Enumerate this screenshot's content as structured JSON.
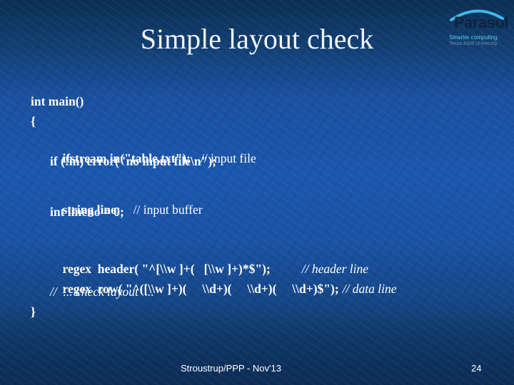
{
  "slide": {
    "title": "Simple layout check",
    "logo": {
      "name": "Parasol",
      "tagline": "Smarter computing.",
      "subtag": "Texas A&M University",
      "colors": {
        "arc": "#3fb8f0",
        "wordmark": "#0d2440",
        "tagline": "#5fd0f0"
      }
    },
    "code": {
      "l1": "int main()",
      "l2": "{",
      "l3_code": "ifstream in(\"table.txt\");",
      "l3_comment": "// input file",
      "l4": "if (!in) error(\"no input file\\n\");",
      "l5_code": "string line;",
      "l5_comment": "// input buffer",
      "l6": "int lineno = 0;",
      "l7_code": "regex  header( \"^[\\\\w ]+(   [\\\\w ]+)*$\");",
      "l7_comment": "// header line",
      "l8_code": "regex  row( \"^([\\\\w ]+)(     \\\\d+)(     \\\\d+)(     \\\\d+)$\");",
      "l8_comment": "// data line",
      "l9": "//  ... check layout  ...",
      "l10": "}"
    },
    "footer": {
      "text": "Stroustrup/PPP - Nov'13",
      "page_number": "24"
    },
    "colors": {
      "background_top": "#0b2f52",
      "background_mid": "#1b57ad",
      "text": "#ffffff"
    }
  }
}
